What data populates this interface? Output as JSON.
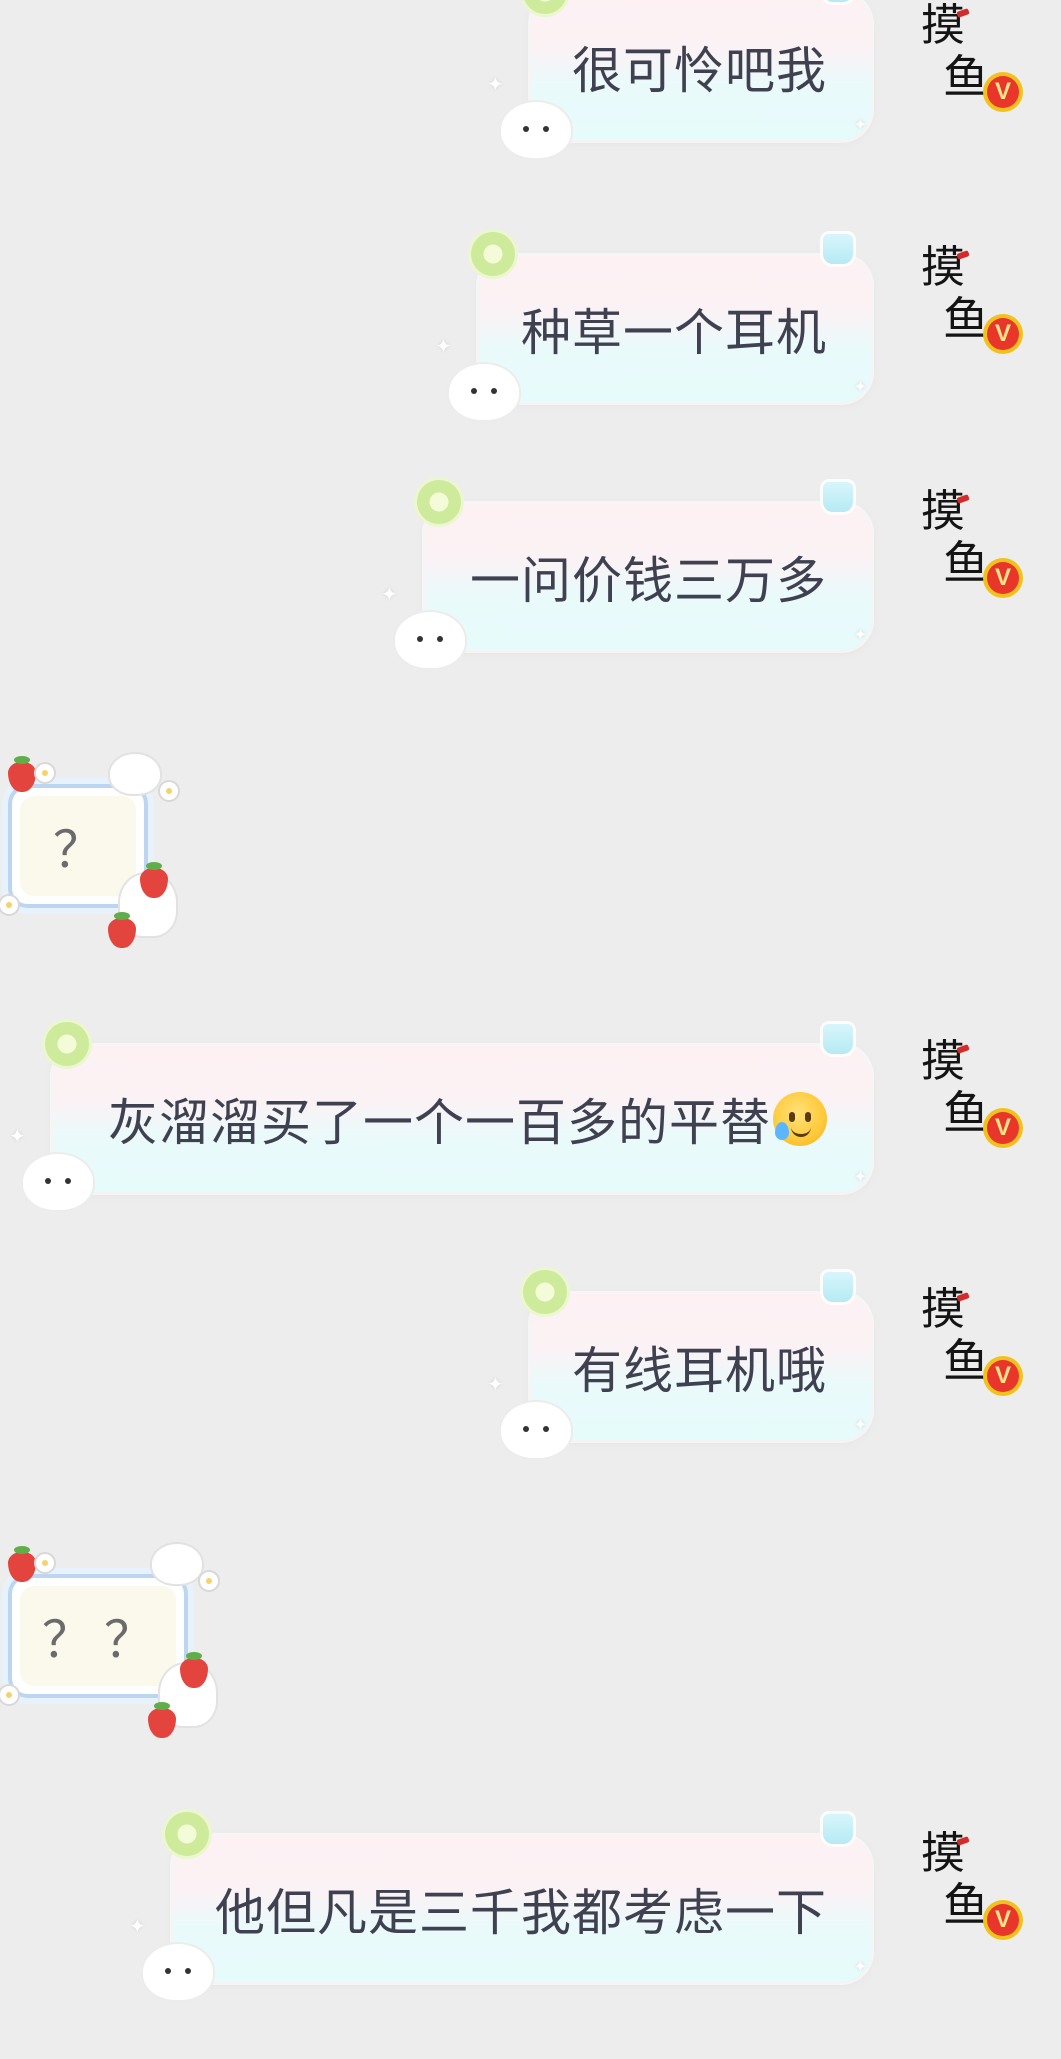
{
  "colors": {
    "background": "#ededed",
    "text_out": "#3f4150",
    "text_in": "#6b6b6b",
    "badge_gold": "#f2c21c",
    "badge_red": "#e8362b"
  },
  "avatar": {
    "line1": "摸",
    "line2": "鱼",
    "badge": "V"
  },
  "messages": [
    {
      "side": "out",
      "text": "很可怜吧我"
    },
    {
      "side": "out",
      "text": "种草一个耳机"
    },
    {
      "side": "out",
      "text": "一问价钱三万多"
    },
    {
      "side": "in",
      "text": "？"
    },
    {
      "side": "out",
      "text": "灰溜溜买了一个一百多的平替",
      "emoji": "smiling-face-with-tear"
    },
    {
      "side": "out",
      "text": "有线耳机哦"
    },
    {
      "side": "in",
      "text": "？？"
    },
    {
      "side": "out",
      "text": "他但凡是三千我都考虑一下"
    }
  ]
}
